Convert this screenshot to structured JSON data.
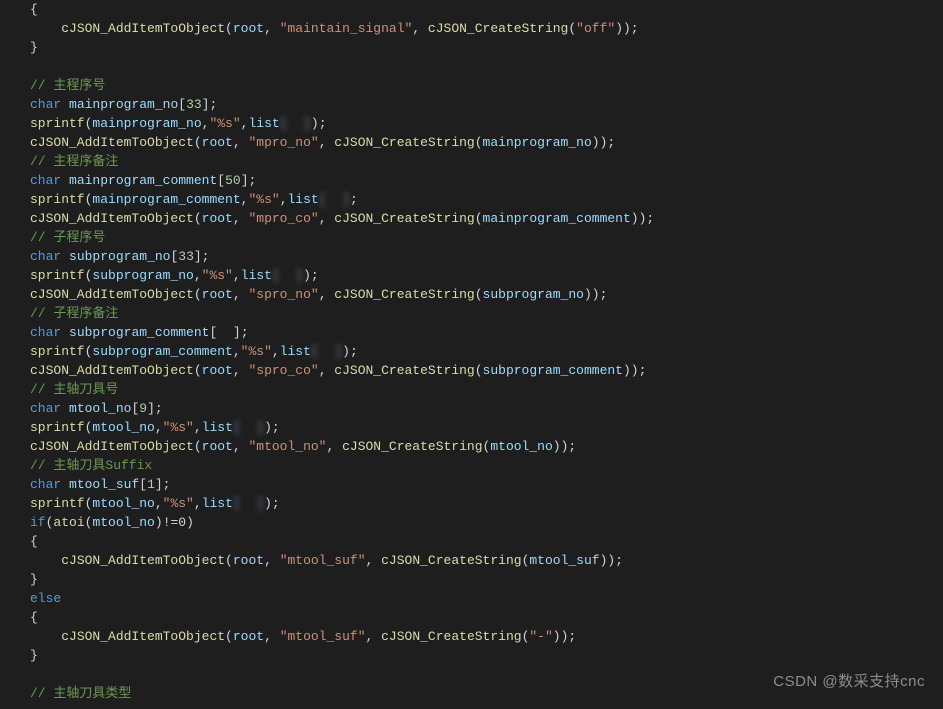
{
  "lines": {
    "l1": "{",
    "l2_fn": "cJSON_AddItemToObject",
    "l2_root": "root",
    "l2_key": "\"maintain_signal\"",
    "l2_fn2": "cJSON_CreateString",
    "l2_val": "\"off\"",
    "l3": "}",
    "c_mainno": "// 主程序号",
    "kw_char": "char",
    "v_mainno": "mainprogram_no",
    "sz33": "33",
    "fn_sprintf": "sprintf",
    "fmt_s": "\"%s\"",
    "v_list": "list",
    "blur_idx": "[  ]",
    "fn_add": "cJSON_AddItemToObject",
    "key_mprono": "\"mpro_no\"",
    "fn_cstr": "cJSON_CreateString",
    "c_maincm": "// 主程序备注",
    "v_maincm": "mainprogram_comment",
    "sz50": "50",
    "key_mproco": "\"mpro_co\"",
    "c_subno": "// 子程序号",
    "v_subno": "subprogram_no",
    "key_sprono": "\"spro_no\"",
    "c_subcm": "// 子程序备注",
    "v_subcm": "subprogram_comment",
    "key_sproco": "\"spro_co\"",
    "c_mtool": "// 主轴刀具号",
    "v_mtoolno": "mtool_no",
    "sz9": "9",
    "key_mtoolno": "\"mtool_no\"",
    "c_mtoolsuf": "// 主轴刀具Suffix",
    "v_mtoolsuf": "mtool_suf",
    "sz1": "1",
    "kw_if": "if",
    "fn_atoi": "atoi",
    "ne0": "!=0",
    "key_mtoolsuf": "\"mtool_suf\"",
    "kw_else": "else",
    "dash": "\"-\"",
    "c_mtooltype": "// 主轴刀具类型",
    "watermark": "CSDN @数采支持cnc"
  }
}
